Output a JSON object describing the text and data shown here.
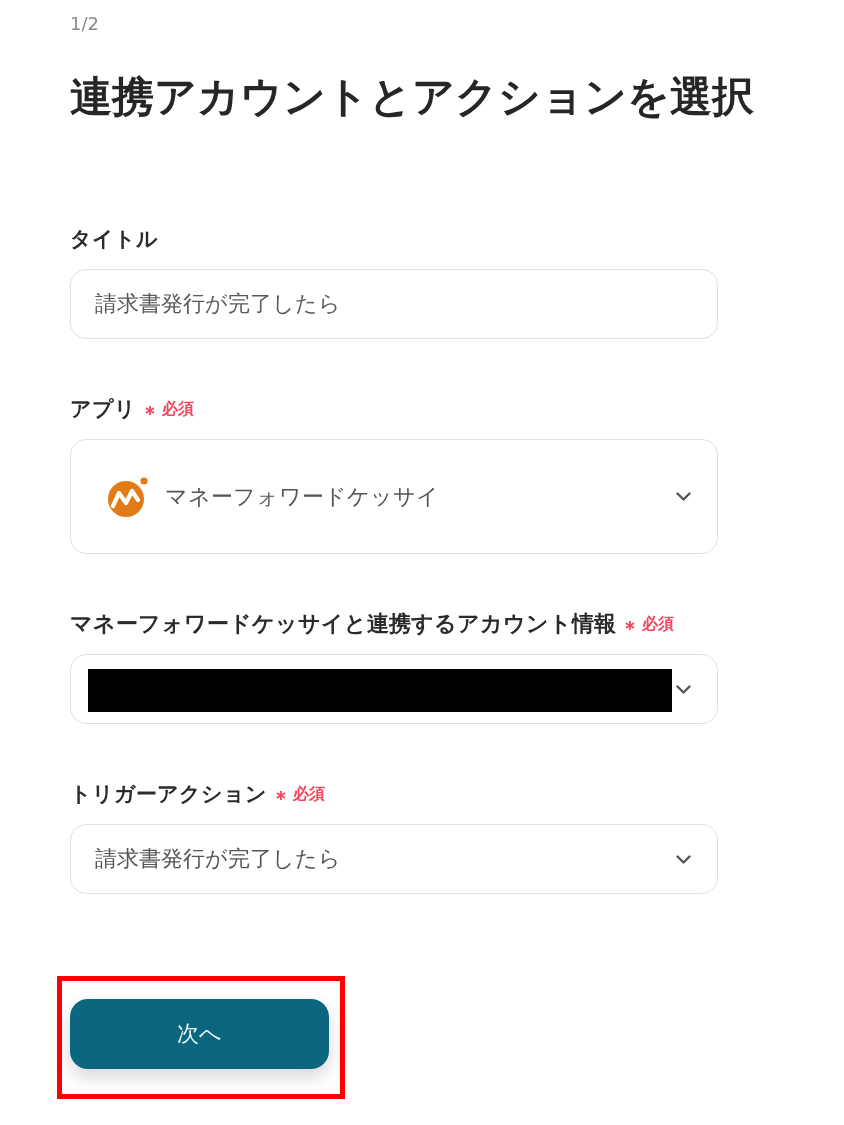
{
  "step": "1/2",
  "title": "連携アカウントとアクションを選択",
  "fields": [
    {
      "kind": "text",
      "label": "タイトル",
      "value": "請求書発行が完了したら"
    },
    {
      "kind": "app_select",
      "label": "アプリ",
      "required_mark": "＊",
      "required_text": "必須",
      "value": "マネーフォワードケッサイ"
    },
    {
      "kind": "select",
      "label": "マネーフォワードケッサイと連携するアカウント情報",
      "required_mark": "＊",
      "required_text": "必須",
      "redacted": true
    },
    {
      "kind": "select",
      "label": "トリガーアクション",
      "required_mark": "＊",
      "required_text": "必須",
      "value": "請求書発行が完了したら"
    }
  ],
  "next_button": {
    "label": "次へ",
    "highlighted": true
  }
}
